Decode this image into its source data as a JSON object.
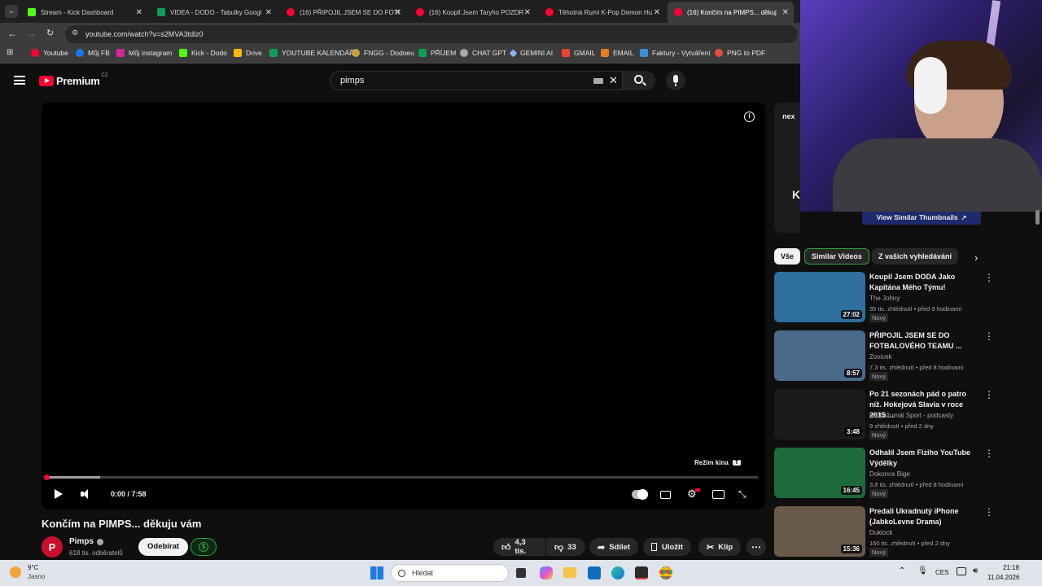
{
  "browser": {
    "tabs": [
      {
        "label": "Stream - Kick Dashboard",
        "color": "#53fc18"
      },
      {
        "label": "VIDEA - DODO - Tabulky Googl",
        "color": "#0f9d58"
      },
      {
        "label": "(16) PŘIPOJIL JSEM SE DO FOTI",
        "color": "#ff0033"
      },
      {
        "label": "(16) Koupil Jsem Taryho POZDR",
        "color": "#ff0033"
      },
      {
        "label": "Těhotná Rumi K-Pop Demon Hu",
        "color": "#ff0033"
      },
      {
        "label": "(16) Končím na PIMPS... děkuj",
        "color": "#ff0033"
      }
    ],
    "url": "youtube.com/watch?v=s2MVA3tdlz0",
    "bookmarks": [
      "Youtube",
      "Můj FB",
      "Můj instagram",
      "Kick - Dodo",
      "Drive",
      "YOUTUBE KALENDÁŘ",
      "FNGG - Dodoeu",
      "PŘÍJEM",
      "CHAT GPT",
      "GEMINI AI",
      "GMAIL",
      "EMAIL",
      "Faktury - Vytváření",
      "PNG to PDF"
    ]
  },
  "youtube": {
    "logo": "Premium",
    "region": "CZ",
    "search_value": "pimps",
    "player": {
      "time": "0:00 / 7:58",
      "cinema_label": "Režim kina",
      "cinema_key": "T",
      "progress": 0.075
    },
    "video": {
      "title": "Končím na PIMPS... děkuju vám",
      "channel": "Pimps",
      "channel_initial": "P",
      "subscribers": "618 tis. odběratelů",
      "subscribe_label": "Odebírat",
      "likes": "4,3 tis.",
      "dislikes": "33",
      "share_label": "Sdílet",
      "save_label": "Uložit",
      "clip_label": "Klip"
    },
    "sidebar": {
      "ad_button": "View Similar Thumbnails",
      "chips": [
        "Vše",
        "Similar Videos",
        "Z vašich vyhledávání"
      ],
      "recommendations": [
        {
          "title": "Koupil Jsem DODA Jako Kapitána Mého Týmu!",
          "channel": "The Johny",
          "meta": "35 tis. zhlédnutí • před 9 hodinami",
          "badge": "Nový",
          "duration": "27:02",
          "thumb_color": "#2e6f9e"
        },
        {
          "title": "PŘIPOJIL JSEM SE DO FOTBALOVÉHO TEAMU ...",
          "channel": "Zovicek",
          "meta": "7,3 tis. zhlédnutí • před 8 hodinami",
          "badge": "Nový",
          "duration": "8:57",
          "thumb_color": "#4a6a8a"
        },
        {
          "title": "Po 21 sezonách pád o patro níž. Hokejová Slavia v roce 2015 ...",
          "channel": "Radiožurnál Sport - podcasty",
          "meta": "9 zhlédnutí • před 2 dny",
          "badge": "Nový",
          "duration": "3:48",
          "thumb_color": "#1b1b1b"
        },
        {
          "title": "Odhalil Jsem Fiziho YouTube Výdělky",
          "channel": "Dokonce Bige",
          "meta": "3,8 tis. zhlédnutí • před 8 hodinami",
          "badge": "Nový",
          "duration": "16:45",
          "thumb_color": "#1d6b3a"
        },
        {
          "title": "Predali Ukradnutý iPhone (JabkoLevne Drama)",
          "channel": "Duklock",
          "meta": "160 tis. zhlédnutí • před 2 dny",
          "badge": "Nový",
          "duration": "15:36",
          "thumb_color": "#6a5a4a"
        }
      ]
    }
  },
  "taskbar": {
    "weather_temp": "9°C",
    "weather_text": "Jasno",
    "search_placeholder": "Hledat",
    "lang": "CES",
    "time": "21:18",
    "date": "11.04.2026"
  },
  "colors": {
    "accent": "#ff0033",
    "bg": "#0f0f0f"
  }
}
